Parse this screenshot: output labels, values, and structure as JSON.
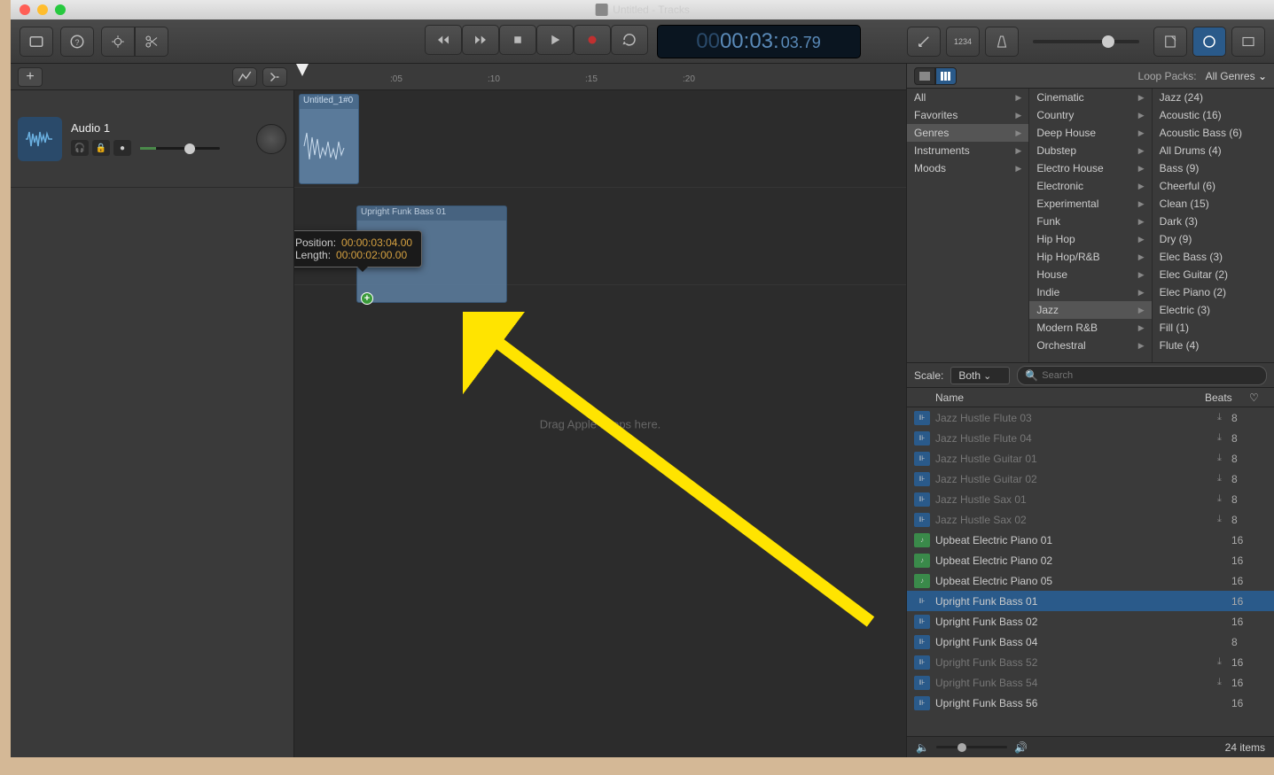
{
  "window_title": "Untitled - Tracks",
  "lcd": {
    "hours": "00",
    "time_main": "00:03:",
    "time_sub": "03.79"
  },
  "ruler_marks": [
    ":05",
    ":10",
    ":15",
    ":20"
  ],
  "track": {
    "name": "Audio 1",
    "region_name": "Untitled_1#0"
  },
  "dragging_region": {
    "name": "Upright Funk Bass 01",
    "tooltip_position_label": "Position:",
    "tooltip_position_value": "00:00:03:04.00",
    "tooltip_length_label": "Length:",
    "tooltip_length_value": "00:00:02:00.00"
  },
  "drag_hint": "Drag Apple Loops here.",
  "browser": {
    "loop_packs_label": "Loop Packs:",
    "loop_packs_value": "All Genres",
    "scale_label": "Scale:",
    "scale_value": "Both",
    "search_placeholder": "Search",
    "col1": [
      {
        "label": "All",
        "sel": false
      },
      {
        "label": "Favorites",
        "sel": false
      },
      {
        "label": "Genres",
        "sel": true
      },
      {
        "label": "Instruments",
        "sel": false
      },
      {
        "label": "Moods",
        "sel": false
      }
    ],
    "col2": [
      {
        "label": "Cinematic"
      },
      {
        "label": "Country"
      },
      {
        "label": "Deep House"
      },
      {
        "label": "Dubstep"
      },
      {
        "label": "Electro House"
      },
      {
        "label": "Electronic"
      },
      {
        "label": "Experimental"
      },
      {
        "label": "Funk"
      },
      {
        "label": "Hip Hop"
      },
      {
        "label": "Hip Hop/R&B"
      },
      {
        "label": "House"
      },
      {
        "label": "Indie"
      },
      {
        "label": "Jazz",
        "sel": true
      },
      {
        "label": "Modern R&B"
      },
      {
        "label": "Orchestral"
      }
    ],
    "col3": [
      {
        "label": "Jazz (24)"
      },
      {
        "label": "Acoustic (16)"
      },
      {
        "label": "Acoustic Bass (6)"
      },
      {
        "label": "All Drums (4)"
      },
      {
        "label": "Bass (9)"
      },
      {
        "label": "Cheerful (6)"
      },
      {
        "label": "Clean (15)"
      },
      {
        "label": "Dark (3)"
      },
      {
        "label": "Dry (9)"
      },
      {
        "label": "Elec Bass (3)"
      },
      {
        "label": "Elec Guitar (2)"
      },
      {
        "label": "Elec Piano (2)"
      },
      {
        "label": "Electric (3)"
      },
      {
        "label": "Fill (1)"
      },
      {
        "label": "Flute (4)"
      }
    ],
    "header_name": "Name",
    "header_beats": "Beats",
    "results": [
      {
        "name": "Jazz Hustle Flute 03",
        "beats": "8",
        "type": "audio",
        "dim": true,
        "dl": true
      },
      {
        "name": "Jazz Hustle Flute 04",
        "beats": "8",
        "type": "audio",
        "dim": true,
        "dl": true
      },
      {
        "name": "Jazz Hustle Guitar 01",
        "beats": "8",
        "type": "audio",
        "dim": true,
        "dl": true
      },
      {
        "name": "Jazz Hustle Guitar 02",
        "beats": "8",
        "type": "audio",
        "dim": true,
        "dl": true
      },
      {
        "name": "Jazz Hustle Sax 01",
        "beats": "8",
        "type": "audio",
        "dim": true,
        "dl": true
      },
      {
        "name": "Jazz Hustle Sax 02",
        "beats": "8",
        "type": "audio",
        "dim": true,
        "dl": true
      },
      {
        "name": "Upbeat Electric Piano 01",
        "beats": "16",
        "type": "midi"
      },
      {
        "name": "Upbeat Electric Piano 02",
        "beats": "16",
        "type": "midi"
      },
      {
        "name": "Upbeat Electric Piano 05",
        "beats": "16",
        "type": "midi"
      },
      {
        "name": "Upright Funk Bass 01",
        "beats": "16",
        "type": "audio",
        "sel": true
      },
      {
        "name": "Upright Funk Bass 02",
        "beats": "16",
        "type": "audio"
      },
      {
        "name": "Upright Funk Bass 04",
        "beats": "8",
        "type": "audio"
      },
      {
        "name": "Upright Funk Bass 52",
        "beats": "16",
        "type": "audio",
        "dim": true,
        "dl": true
      },
      {
        "name": "Upright Funk Bass 54",
        "beats": "16",
        "type": "audio",
        "dim": true,
        "dl": true
      },
      {
        "name": "Upright Funk Bass 56",
        "beats": "16",
        "type": "audio"
      }
    ],
    "footer_count": "24 items"
  }
}
